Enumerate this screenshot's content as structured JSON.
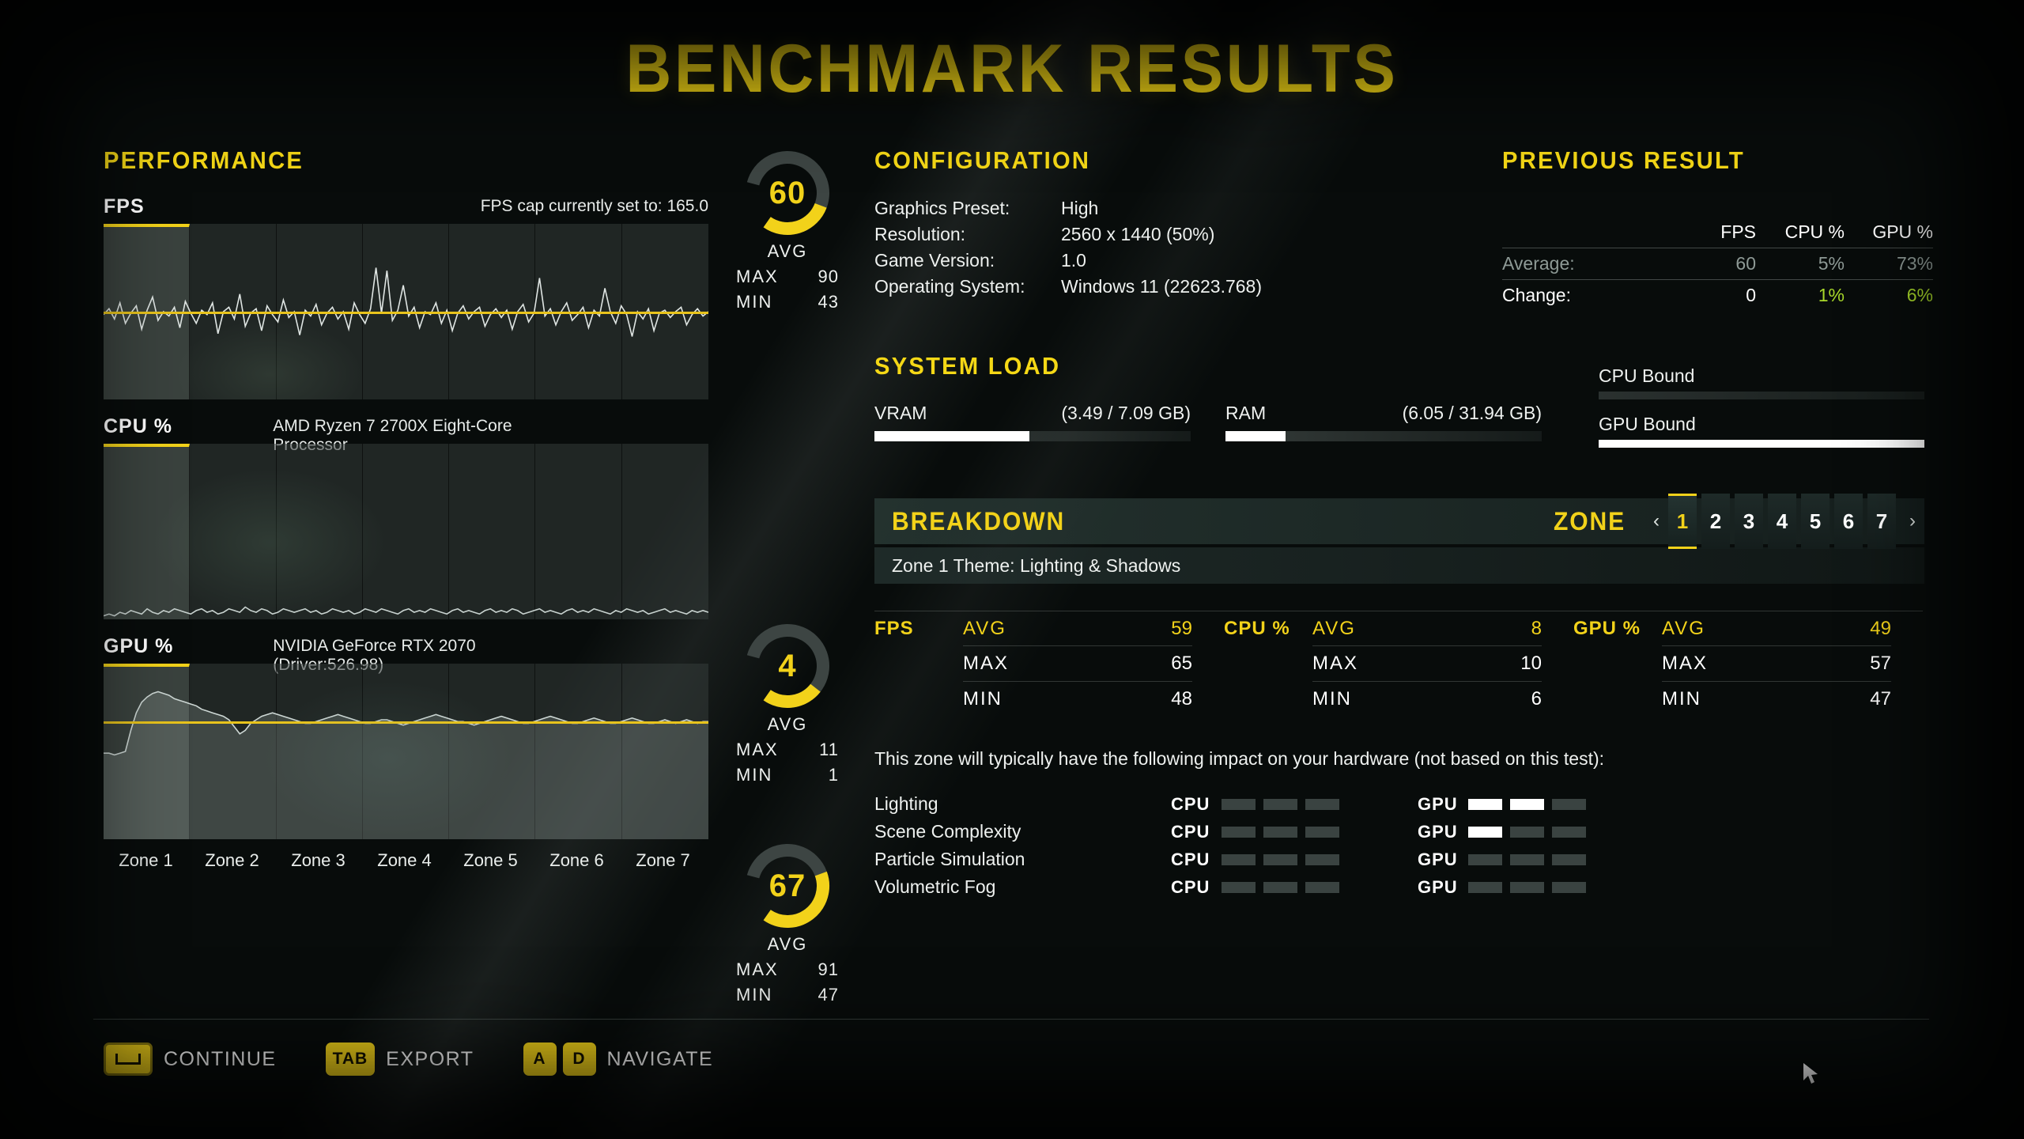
{
  "title": "BENCHMARK RESULTS",
  "colors": {
    "accent": "#f2d21a",
    "positive": "#a8d82a",
    "dim": "#8e9a96",
    "white": "#ffffff"
  },
  "performance": {
    "heading": "PERFORMANCE",
    "fps_cap_note": "FPS cap currently set to: 165.0",
    "zone_labels": [
      "Zone 1",
      "Zone 2",
      "Zone 3",
      "Zone 4",
      "Zone 5",
      "Zone 6",
      "Zone 7"
    ],
    "graphs": [
      {
        "label": "FPS",
        "subtitle": "FPS cap currently set to: 165.0",
        "avg": 60,
        "avg_caption": "AVG",
        "max_label": "MAX",
        "max": 90,
        "min_label": "MIN",
        "min": 43,
        "gauge_pct": 36
      },
      {
        "label": "CPU %",
        "subtitle": "AMD Ryzen 7 2700X Eight-Core Processor",
        "avg": 4,
        "avg_caption": "AVG",
        "max_label": "MAX",
        "max": 11,
        "min_label": "MIN",
        "min": 1,
        "gauge_pct": 30
      },
      {
        "label": "GPU %",
        "subtitle": "NVIDIA GeForce RTX 2070 (Driver:526.98)",
        "avg": 67,
        "avg_caption": "AVG",
        "max_label": "MAX",
        "max": 91,
        "min_label": "MIN",
        "min": 47,
        "gauge_pct": 50
      }
    ]
  },
  "configuration": {
    "heading": "CONFIGURATION",
    "rows": [
      {
        "key": "Graphics Preset:",
        "value": "High"
      },
      {
        "key": "Resolution:",
        "value": "2560 x 1440 (50%)"
      },
      {
        "key": "Game Version:",
        "value": "1.0"
      },
      {
        "key": "Operating System:",
        "value": "Windows 11 (22623.768)"
      }
    ]
  },
  "previous_result": {
    "heading": "PREVIOUS RESULT",
    "columns": [
      "FPS",
      "CPU %",
      "GPU %"
    ],
    "rows": [
      {
        "label": "Average:",
        "values": [
          "60",
          "5%",
          "73%"
        ]
      },
      {
        "label": "Change:",
        "values": [
          "0",
          "1%",
          "6%"
        ]
      }
    ]
  },
  "system_load": {
    "heading": "SYSTEM LOAD",
    "bars": [
      {
        "label": "VRAM",
        "value": "(3.49 / 7.09 GB)",
        "pct": 49
      },
      {
        "label": "RAM",
        "value": "(6.05 / 31.94 GB)",
        "pct": 19
      }
    ],
    "bound": [
      {
        "label": "CPU Bound",
        "pct": 0
      },
      {
        "label": "GPU Bound",
        "pct": 100
      }
    ]
  },
  "breakdown": {
    "heading": "BREAKDOWN",
    "zone_word": "ZONE",
    "prev_arrow": "‹",
    "next_arrow": "›",
    "zones": [
      "1",
      "2",
      "3",
      "4",
      "5",
      "6",
      "7"
    ],
    "selected_zone": "1",
    "theme": "Zone 1 Theme: Lighting & Shadows",
    "stat_groups": [
      {
        "name": "FPS",
        "rows": [
          {
            "k": "AVG",
            "v": "59"
          },
          {
            "k": "MAX",
            "v": "65"
          },
          {
            "k": "MIN",
            "v": "48"
          }
        ]
      },
      {
        "name": "CPU %",
        "rows": [
          {
            "k": "AVG",
            "v": "8"
          },
          {
            "k": "MAX",
            "v": "10"
          },
          {
            "k": "MIN",
            "v": "6"
          }
        ]
      },
      {
        "name": "GPU %",
        "rows": [
          {
            "k": "AVG",
            "v": "49"
          },
          {
            "k": "MAX",
            "v": "57"
          },
          {
            "k": "MIN",
            "v": "47"
          }
        ]
      }
    ],
    "impact_note": "This zone will typically have the following impact on your hardware (not based on this test):",
    "impact_rows": [
      {
        "name": "Lighting",
        "cpu_tag": "CPU",
        "cpu": [
          0,
          0,
          0
        ],
        "gpu_tag": "GPU",
        "gpu": [
          1,
          1,
          0
        ]
      },
      {
        "name": "Scene Complexity",
        "cpu_tag": "CPU",
        "cpu": [
          0,
          0,
          0
        ],
        "gpu_tag": "GPU",
        "gpu": [
          1,
          0,
          0
        ]
      },
      {
        "name": "Particle Simulation",
        "cpu_tag": "CPU",
        "cpu": [
          0,
          0,
          0
        ],
        "gpu_tag": "GPU",
        "gpu": [
          0,
          0,
          0
        ]
      },
      {
        "name": "Volumetric Fog",
        "cpu_tag": "CPU",
        "cpu": [
          0,
          0,
          0
        ],
        "gpu_tag": "GPU",
        "gpu": [
          0,
          0,
          0
        ]
      }
    ]
  },
  "footer": {
    "items": [
      {
        "key_type": "space",
        "key_label": "",
        "action": "CONTINUE"
      },
      {
        "key_type": "badge",
        "key_label": "TAB",
        "action": "EXPORT"
      },
      {
        "key_type": "pair",
        "key_label": "A",
        "key_label2": "D",
        "action": "NAVIGATE"
      }
    ]
  },
  "chart_data": [
    {
      "type": "line",
      "title": "FPS",
      "ylabel": "FPS",
      "xlabel": "Zone",
      "categories": [
        "Zone 1",
        "Zone 2",
        "Zone 3",
        "Zone 4",
        "Zone 5",
        "Zone 6",
        "Zone 7"
      ],
      "ylim": [
        0,
        120
      ],
      "cap_line": 60,
      "avg": 60,
      "max": 90,
      "min": 43,
      "values": [
        58,
        62,
        55,
        66,
        52,
        59,
        64,
        48,
        61,
        70,
        54,
        60,
        57,
        63,
        49,
        67,
        59,
        52,
        61,
        58,
        66,
        45,
        60,
        63,
        55,
        72,
        50,
        59,
        62,
        47,
        64,
        58,
        53,
        68,
        56,
        60,
        44,
        61,
        57,
        65,
        51,
        59,
        63,
        55,
        60,
        48,
        66,
        58,
        52,
        62,
        90,
        59,
        88,
        54,
        61,
        78,
        57,
        63,
        49,
        60,
        58,
        66,
        52,
        61,
        47,
        59,
        64,
        55,
        60,
        63,
        50,
        58,
        62,
        56,
        61,
        48,
        60,
        65,
        53,
        59,
        83,
        57,
        62,
        51,
        60,
        66,
        54,
        58,
        63,
        49,
        61,
        57,
        76,
        60,
        52,
        64,
        58,
        43,
        60,
        55,
        62,
        47,
        59,
        61,
        56,
        60,
        63,
        51,
        58,
        62,
        57,
        60
      ]
    },
    {
      "type": "line",
      "title": "CPU %",
      "ylabel": "CPU %",
      "xlabel": "Zone",
      "categories": [
        "Zone 1",
        "Zone 2",
        "Zone 3",
        "Zone 4",
        "Zone 5",
        "Zone 6",
        "Zone 7"
      ],
      "ylim": [
        0,
        100
      ],
      "cap_line": 4,
      "avg": 4,
      "max": 11,
      "min": 1,
      "values": [
        2,
        3,
        2,
        4,
        3,
        5,
        4,
        3,
        6,
        4,
        3,
        5,
        4,
        6,
        5,
        4,
        3,
        5,
        6,
        4,
        5,
        3,
        4,
        6,
        5,
        4,
        7,
        5,
        4,
        6,
        5,
        3,
        4,
        6,
        5,
        4,
        5,
        6,
        4,
        5,
        3,
        4,
        6,
        5,
        4,
        5,
        3,
        4,
        6,
        5,
        4,
        6,
        5,
        4,
        3,
        5,
        6,
        4,
        5,
        4,
        6,
        5,
        4,
        3,
        5,
        6,
        4,
        5,
        4,
        3,
        5,
        6,
        4,
        5,
        4,
        6,
        5,
        3,
        4,
        5,
        6,
        4,
        5,
        4,
        3,
        5,
        6,
        4,
        5,
        4,
        6,
        5,
        4,
        3,
        5,
        4,
        6,
        5,
        4,
        5,
        3,
        4,
        5,
        6,
        4,
        5,
        4,
        3,
        5,
        4,
        5,
        4
      ]
    },
    {
      "type": "area",
      "title": "GPU %",
      "ylabel": "GPU %",
      "xlabel": "Zone",
      "categories": [
        "Zone 1",
        "Zone 2",
        "Zone 3",
        "Zone 4",
        "Zone 5",
        "Zone 6",
        "Zone 7"
      ],
      "ylim": [
        0,
        100
      ],
      "cap_line": 67,
      "avg": 67,
      "max": 91,
      "min": 47,
      "values": [
        49,
        49,
        48,
        49,
        50,
        62,
        72,
        78,
        81,
        83,
        84,
        83,
        82,
        80,
        79,
        78,
        77,
        76,
        74,
        73,
        72,
        71,
        70,
        68,
        64,
        60,
        62,
        66,
        68,
        70,
        71,
        72,
        71,
        70,
        69,
        68,
        67,
        66,
        66,
        67,
        68,
        69,
        70,
        71,
        70,
        69,
        68,
        67,
        66,
        66,
        67,
        68,
        68,
        67,
        66,
        65,
        66,
        67,
        68,
        69,
        70,
        71,
        70,
        69,
        68,
        67,
        67,
        66,
        65,
        66,
        67,
        68,
        69,
        70,
        69,
        68,
        67,
        66,
        66,
        67,
        68,
        69,
        70,
        69,
        68,
        67,
        66,
        66,
        67,
        68,
        69,
        68,
        67,
        66,
        66,
        67,
        68,
        69,
        68,
        67,
        66,
        66,
        67,
        68,
        67,
        66,
        67,
        68,
        67,
        66,
        67,
        67
      ]
    }
  ]
}
